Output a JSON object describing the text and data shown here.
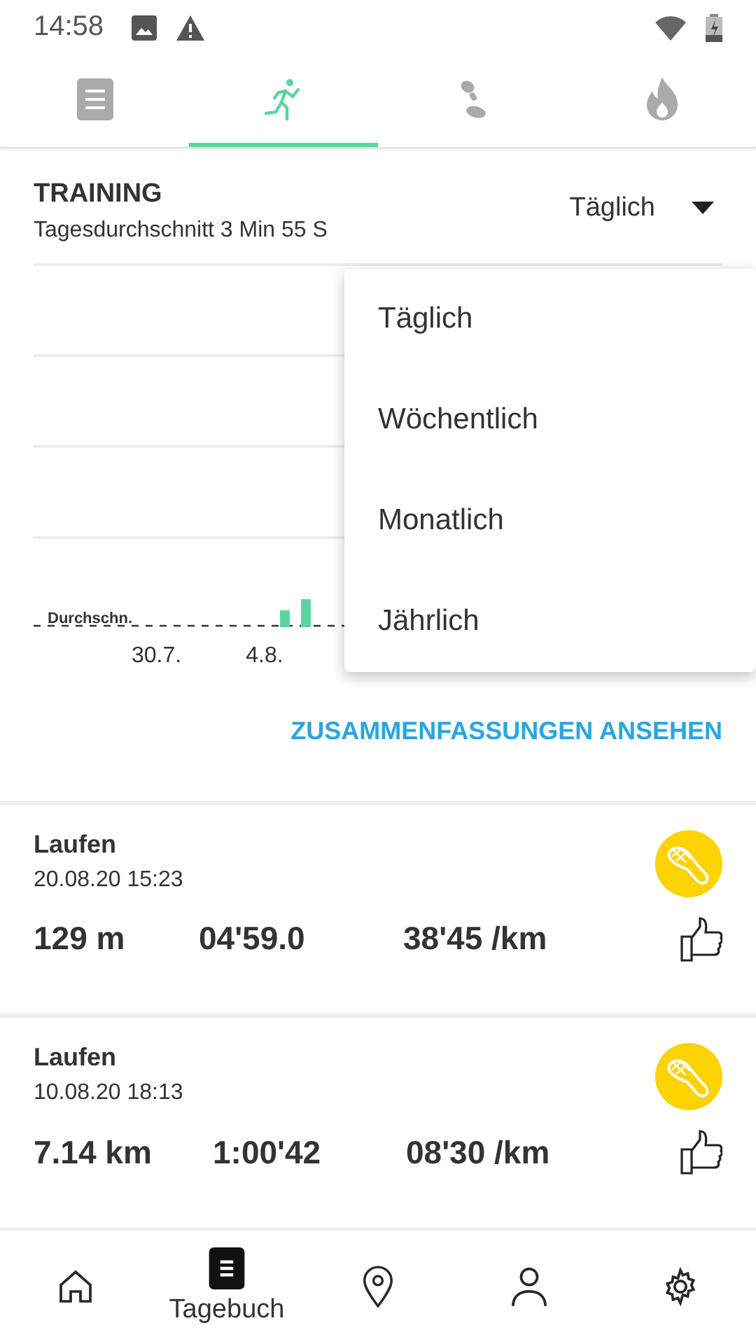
{
  "status_bar": {
    "time": "14:58"
  },
  "tabs": [
    {
      "kind": "diary",
      "selected": false
    },
    {
      "kind": "run",
      "selected": true
    },
    {
      "kind": "steps",
      "selected": false
    },
    {
      "kind": "calories",
      "selected": false
    }
  ],
  "training": {
    "title": "TRAINING",
    "subtitle": "Tagesdurchschnitt 3 Min 55 S",
    "period": "Täglich",
    "average_label": "Durchschn.",
    "x_labels": [
      "30.7.",
      "4.8."
    ],
    "summary_link": "ZUSAMMENFASSUNGEN ANSEHEN"
  },
  "period_menu": [
    {
      "label": "Täglich"
    },
    {
      "label": "Wöchentlich"
    },
    {
      "label": "Monatlich"
    },
    {
      "label": "Jährlich"
    }
  ],
  "activities": [
    {
      "name": "Laufen",
      "date": "20.08.20 15:23",
      "distance": "129 m",
      "duration": "04'59.0",
      "pace": "38'45 /km"
    },
    {
      "name": "Laufen",
      "date": "10.08.20 18:13",
      "distance": "7.14 km",
      "duration": "1:00'42",
      "pace": "08'30 /km"
    }
  ],
  "bottom_nav": [
    {
      "kind": "home",
      "selected": false
    },
    {
      "kind": "diary",
      "label": "Tagebuch",
      "selected": true
    },
    {
      "kind": "map",
      "selected": false
    },
    {
      "kind": "profile",
      "selected": false
    },
    {
      "kind": "settings",
      "selected": false
    }
  ]
}
